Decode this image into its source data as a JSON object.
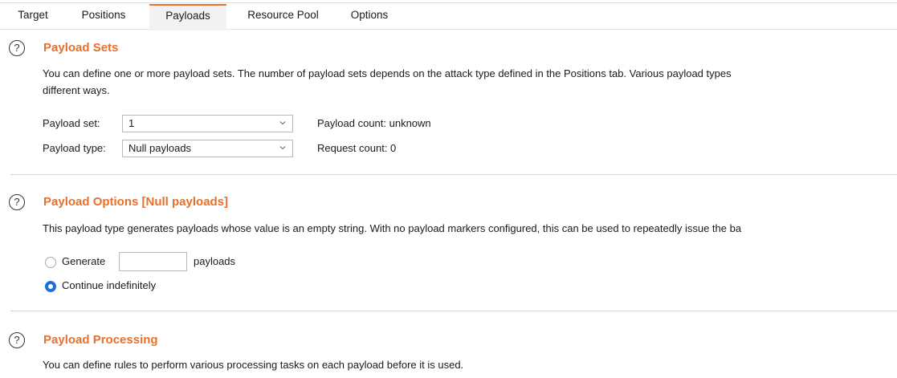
{
  "tabs": [
    {
      "label": "Target",
      "active": false
    },
    {
      "label": "Positions",
      "active": false
    },
    {
      "label": "Payloads",
      "active": true
    },
    {
      "label": "Resource Pool",
      "active": false
    },
    {
      "label": "Options",
      "active": false
    }
  ],
  "colors": {
    "accent": "#e8702a",
    "radio_selected": "#1f6fd8"
  },
  "payload_sets": {
    "title": "Payload Sets",
    "desc_line1": "You can define one or more payload sets. The number of payload sets depends on the attack type defined in the Positions tab. Various payload types",
    "desc_line2": "different ways.",
    "payload_set_label": "Payload set:",
    "payload_set_value": "1",
    "payload_type_label": "Payload type:",
    "payload_type_value": "Null payloads",
    "payload_count": "Payload count: unknown",
    "request_count": "Request count: 0"
  },
  "payload_options": {
    "title": "Payload Options [Null payloads]",
    "desc": "This payload type generates payloads whose value is an empty string. With no payload markers configured, this can be used to repeatedly issue the ba",
    "generate_label": "Generate",
    "generate_value": "",
    "payloads_label": "payloads",
    "continue_label": "Continue indefinitely",
    "selected_option": "Continue indefinitely"
  },
  "payload_processing": {
    "title": "Payload Processing",
    "desc": "You can define rules to perform various processing tasks on each payload before it is used."
  },
  "icons": {
    "help": "help-circle-icon",
    "dropdown": "chevron-down-icon"
  }
}
